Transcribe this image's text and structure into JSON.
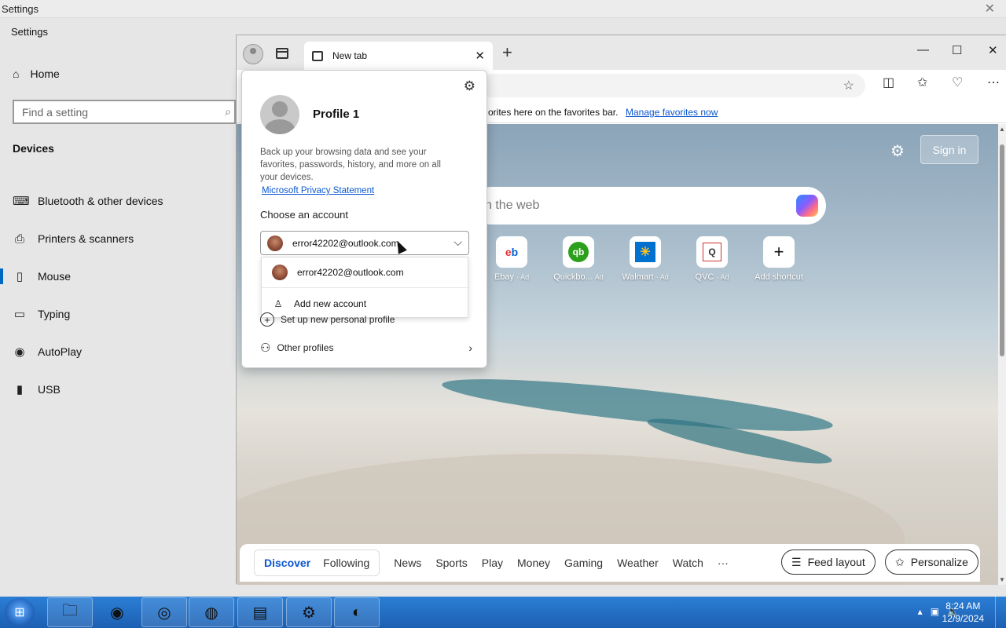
{
  "settings": {
    "titlebar_title": "Settings",
    "app_label": "Settings",
    "home_label": "Home",
    "search_placeholder": "Find a setting",
    "section_heading": "Devices",
    "nav_items": [
      {
        "label": "Bluetooth & other devices",
        "icon": "bluetooth-devices-icon"
      },
      {
        "label": "Printers & scanners",
        "icon": "printer-icon"
      },
      {
        "label": "Mouse",
        "icon": "mouse-icon"
      },
      {
        "label": "Typing",
        "icon": "keyboard-icon"
      },
      {
        "label": "AutoPlay",
        "icon": "autoplay-icon"
      },
      {
        "label": "USB",
        "icon": "usb-icon"
      }
    ],
    "active_item": "Mouse"
  },
  "browser": {
    "tab_title": "New tab",
    "favbar_message": "orites here on the favorites bar.",
    "favbar_link": "Manage favorites now",
    "sign_in": "Sign in",
    "search_placeholder": "n the web",
    "shortcuts": [
      {
        "label": "Ebay",
        "ad": "· Ad",
        "icon": "ebay-icon"
      },
      {
        "label": "Quickbo...",
        "ad": "Ad",
        "icon": "quickbooks-icon"
      },
      {
        "label": "Walmart",
        "ad": "· Ad",
        "icon": "walmart-icon"
      },
      {
        "label": "QVC",
        "ad": "· Ad",
        "icon": "qvc-icon"
      },
      {
        "label": "Add shortcut",
        "ad": "",
        "icon": "plus-icon"
      }
    ],
    "feed": {
      "segment": [
        "Discover",
        "Following"
      ],
      "active": "Discover",
      "tabs": [
        "News",
        "Sports",
        "Play",
        "Money",
        "Gaming",
        "Weather",
        "Watch",
        "···"
      ],
      "feed_layout": "Feed layout",
      "personalize": "Personalize"
    }
  },
  "profile_flyout": {
    "profile_name": "Profile 1",
    "description": "Back up your browsing data and see your favorites, passwords, history, and more on all your devices.",
    "privacy_link": "Microsoft Privacy Statement",
    "choose_label": "Choose an account",
    "selected_account": "error42202@outlook.com",
    "dropdown_options": [
      "error42202@outlook.com",
      "Add new account"
    ],
    "setup_profile": "Set up new personal profile",
    "other_profiles": "Other profiles"
  },
  "taskbar": {
    "time": "8:24 AM",
    "date": "12/9/2024",
    "apps": [
      "file-explorer-icon",
      "firefox-icon",
      "browser-globe-icon",
      "chrome-icon",
      "notepad-icon",
      "settings-gear-icon",
      "edge-icon"
    ]
  },
  "colors": {
    "accent": "#0067c0",
    "link": "#0b57d0",
    "taskbar": "#1c5fb2"
  }
}
